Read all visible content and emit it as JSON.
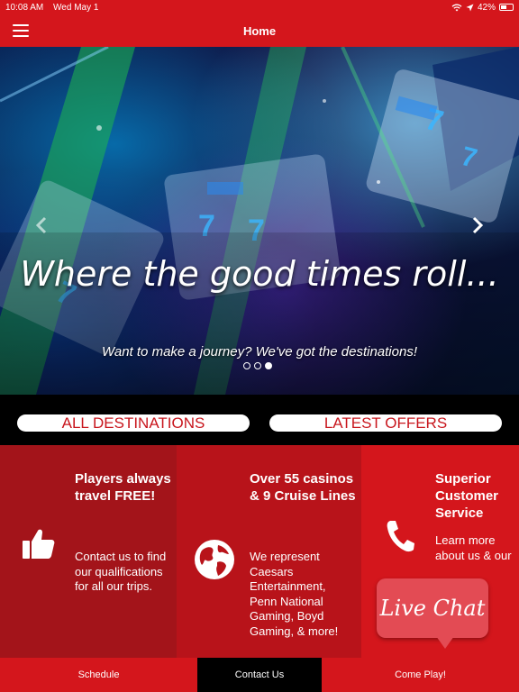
{
  "status_bar": {
    "time": "10:08 AM",
    "date": "Wed May 1",
    "battery": "42%"
  },
  "nav": {
    "title": "Home",
    "menu_icon": "hamburger-icon"
  },
  "hero": {
    "headline": "Where the good times roll...",
    "subheadline": "Want to make a journey? We've got the destinations!",
    "slide_count": 3,
    "active_slide": 3
  },
  "buttons": {
    "all_destinations": "ALL DESTINATIONS",
    "latest_offers": "LATEST OFFERS"
  },
  "features": [
    {
      "icon": "thumbs-up-icon",
      "title": "Players always travel FREE!",
      "body": "Contact us to find our qualifications for all our trips."
    },
    {
      "icon": "globe-icon",
      "title": "Over 55 casinos & 9 Cruise Lines",
      "body": "We represent Caesars Entertainment, Penn National Gaming, Boyd Gaming, & more!"
    },
    {
      "icon": "phone-icon",
      "title": "Superior Customer Service",
      "body": "Learn more about us & our"
    }
  ],
  "live_chat": {
    "label": "Live Chat"
  },
  "tabs": [
    {
      "label": "Schedule",
      "active": false
    },
    {
      "label": "Contact Us",
      "active": true
    },
    {
      "label": "Come Play!",
      "active": false
    }
  ],
  "colors": {
    "brand_red": "#d4161c",
    "dark_red": "#a3141a",
    "mid_red": "#b8131a",
    "chat_red": "#e34b54",
    "black": "#000000"
  }
}
